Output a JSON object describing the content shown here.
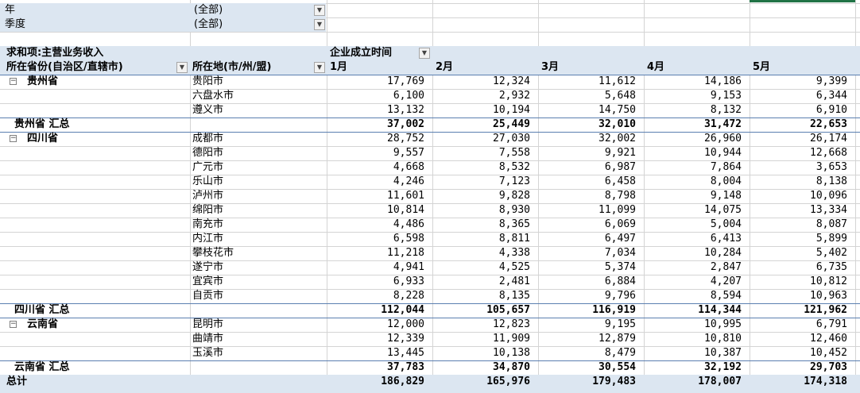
{
  "filters": [
    {
      "label": "年",
      "value": "(全部)"
    },
    {
      "label": "季度",
      "value": "(全部)"
    }
  ],
  "pivot": {
    "value_label": "求和项:主营业务收入",
    "column_field": "企业成立时间",
    "row_field_1": "所在省份(自治区/直辖市)",
    "row_field_2": "所在地(市/州/盟)",
    "months": [
      "1月",
      "2月",
      "3月",
      "4月",
      "5月"
    ]
  },
  "groups": [
    {
      "province": "贵州省",
      "rows": [
        {
          "city": "贵阳市",
          "values": [
            "17,769",
            "12,324",
            "11,612",
            "14,186",
            "9,399"
          ]
        },
        {
          "city": "六盘水市",
          "values": [
            "6,100",
            "2,932",
            "5,648",
            "9,153",
            "6,344"
          ]
        },
        {
          "city": "遵义市",
          "values": [
            "13,132",
            "10,194",
            "14,750",
            "8,132",
            "6,910"
          ]
        }
      ],
      "subtotal_label": "贵州省 汇总",
      "subtotal": [
        "37,002",
        "25,449",
        "32,010",
        "31,472",
        "22,653"
      ]
    },
    {
      "province": "四川省",
      "rows": [
        {
          "city": "成都市",
          "values": [
            "28,752",
            "27,030",
            "32,002",
            "26,960",
            "26,174"
          ]
        },
        {
          "city": "德阳市",
          "values": [
            "9,557",
            "7,558",
            "9,921",
            "10,944",
            "12,668"
          ]
        },
        {
          "city": "广元市",
          "values": [
            "4,668",
            "8,532",
            "6,987",
            "7,864",
            "3,653"
          ]
        },
        {
          "city": "乐山市",
          "values": [
            "4,246",
            "7,123",
            "6,458",
            "8,004",
            "8,138"
          ]
        },
        {
          "city": "泸州市",
          "values": [
            "11,601",
            "9,828",
            "8,798",
            "9,148",
            "10,096"
          ]
        },
        {
          "city": "绵阳市",
          "values": [
            "10,814",
            "8,930",
            "11,099",
            "14,075",
            "13,334"
          ]
        },
        {
          "city": "南充市",
          "values": [
            "4,486",
            "8,365",
            "6,069",
            "5,004",
            "8,087"
          ]
        },
        {
          "city": "内江市",
          "values": [
            "6,598",
            "8,811",
            "6,497",
            "6,413",
            "5,899"
          ]
        },
        {
          "city": "攀枝花市",
          "values": [
            "11,218",
            "4,338",
            "7,034",
            "10,284",
            "5,402"
          ]
        },
        {
          "city": "遂宁市",
          "values": [
            "4,941",
            "4,525",
            "5,374",
            "2,847",
            "6,735"
          ]
        },
        {
          "city": "宜宾市",
          "values": [
            "6,933",
            "2,481",
            "6,884",
            "4,207",
            "10,812"
          ]
        },
        {
          "city": "自贡市",
          "values": [
            "8,228",
            "8,135",
            "9,796",
            "8,594",
            "10,963"
          ]
        }
      ],
      "subtotal_label": "四川省 汇总",
      "subtotal": [
        "112,044",
        "105,657",
        "116,919",
        "114,344",
        "121,962"
      ]
    },
    {
      "province": "云南省",
      "rows": [
        {
          "city": "昆明市",
          "values": [
            "12,000",
            "12,823",
            "9,195",
            "10,995",
            "6,791"
          ]
        },
        {
          "city": "曲靖市",
          "values": [
            "12,339",
            "11,909",
            "12,879",
            "10,810",
            "12,460"
          ]
        },
        {
          "city": "玉溪市",
          "values": [
            "13,445",
            "10,138",
            "8,479",
            "10,387",
            "10,452"
          ]
        }
      ],
      "subtotal_label": "云南省 汇总",
      "subtotal": [
        "37,783",
        "34,870",
        "30,554",
        "32,192",
        "29,703"
      ]
    }
  ],
  "grand_total_label": "总计",
  "grand_total": [
    "186,829",
    "165,976",
    "179,483",
    "178,007",
    "174,318"
  ],
  "icons": {
    "dropdown": "dropdown-arrow-icon",
    "collapse": "collapse-minus-icon"
  },
  "colors": {
    "pivot_header": "#dce6f1",
    "selected_column": "#217346"
  }
}
